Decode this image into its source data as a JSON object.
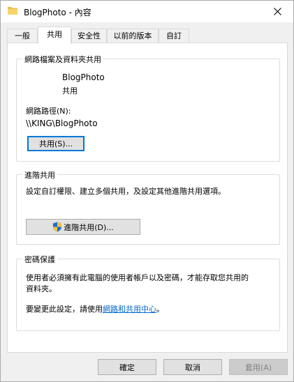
{
  "window": {
    "title": "BlogPhoto - 內容",
    "folder_icon": "folder-icon",
    "close_icon": "close-icon"
  },
  "tabs": [
    {
      "label": "一般",
      "active": false
    },
    {
      "label": "共用",
      "active": true
    },
    {
      "label": "安全性",
      "active": false
    },
    {
      "label": "以前的版本",
      "active": false
    },
    {
      "label": "自訂",
      "active": false
    }
  ],
  "sharing": {
    "group_label": "網路檔案及資料夾共用",
    "folder_name": "BlogPhoto",
    "share_status": "共用",
    "network_path_label": "網路路徑(N):",
    "network_path": "\\\\KING\\BlogPhoto",
    "share_button": "共用(S)..."
  },
  "advanced": {
    "group_label": "進階共用",
    "description": "設定自訂權限、建立多個共用，及設定其他進階共用選項。",
    "button": "進階共用(D)..."
  },
  "password": {
    "group_label": "密碼保護",
    "description_line1": "使用者必須擁有此電腦的使用者帳戶以及密碼，才能存取您共用的",
    "description_line2": "資料夾。",
    "change_prefix": "要變更此設定，請使用",
    "change_link": "網路和共用中心",
    "change_suffix": "。"
  },
  "footer": {
    "ok": "確定",
    "cancel": "取消",
    "apply": "套用(A)"
  },
  "colors": {
    "accent": "#0078d7",
    "link": "#0066cc",
    "shield_blue": "#1f6fd1",
    "shield_yellow": "#f5c242"
  }
}
